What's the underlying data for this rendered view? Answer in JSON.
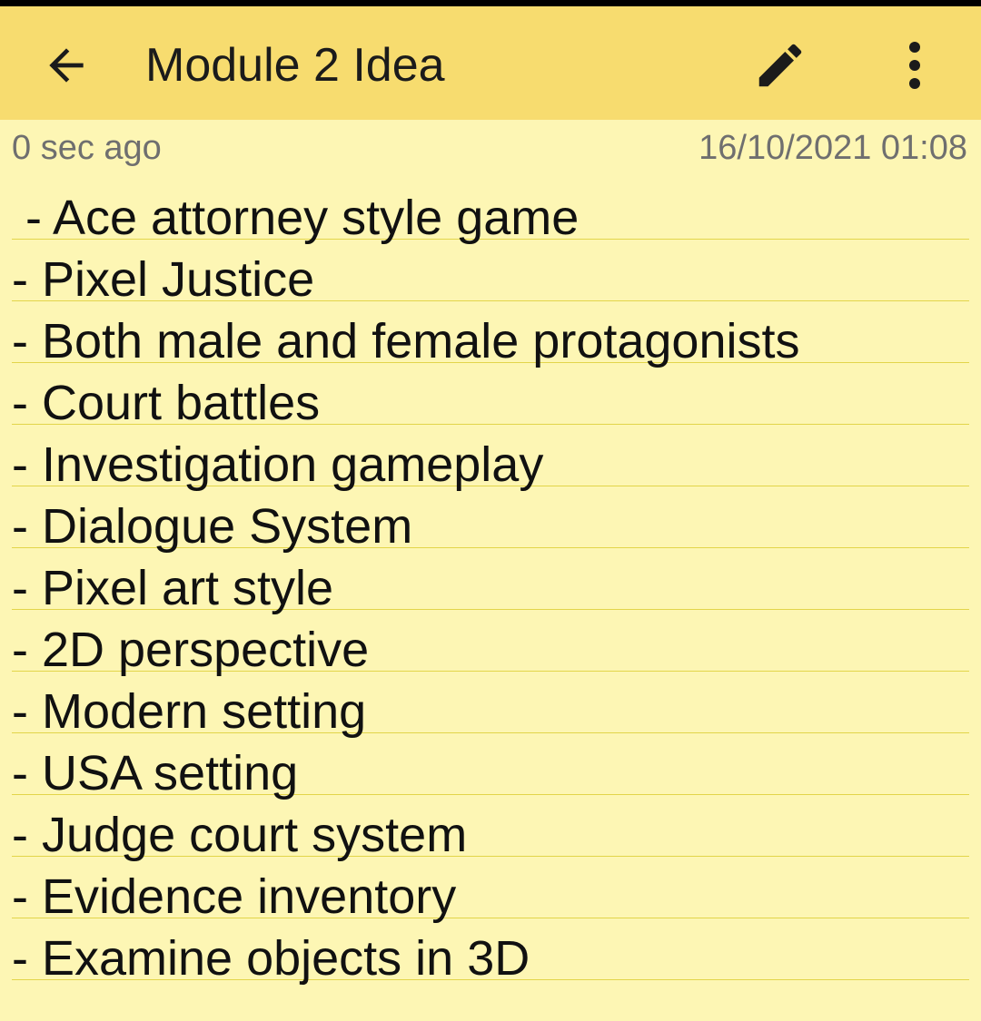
{
  "toolbar": {
    "title": "Module 2 Idea",
    "back_icon": "arrow-left-icon",
    "edit_icon": "pencil-icon",
    "more_icon": "more-vertical-icon"
  },
  "meta": {
    "modified_ago": "0 sec ago",
    "created_date": "16/10/2021 01:08"
  },
  "note": {
    "lines": [
      " - Ace attorney style game",
      "- Pixel Justice",
      "- Both male and female protagonists",
      "- Court battles",
      "- Investigation gameplay",
      "- Dialogue System",
      "- Pixel art style",
      "- 2D perspective",
      "- Modern setting",
      "- USA setting",
      "- Judge court system",
      "- Evidence inventory",
      "- Examine objects in 3D"
    ]
  },
  "colors": {
    "toolbar_bg": "#f7dc6f",
    "note_bg": "#fdf6b4",
    "rule_line": "#e2d54a",
    "meta_text": "#6f6f6f"
  }
}
